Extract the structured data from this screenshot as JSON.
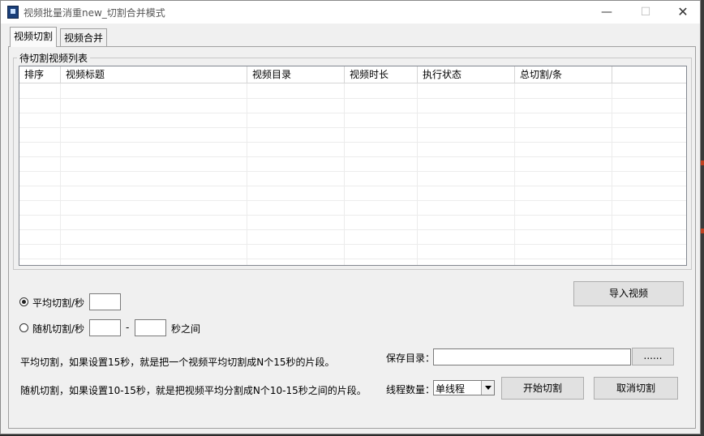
{
  "window": {
    "title": "视频批量消重new_切割合并模式"
  },
  "tabs": [
    {
      "label": "视频切割",
      "active": true
    },
    {
      "label": "视频合并",
      "active": false
    }
  ],
  "list": {
    "group_title": "待切割视频列表",
    "columns": [
      "排序",
      "视频标题",
      "视频目录",
      "视频时长",
      "执行状态",
      "总切割/条",
      ""
    ],
    "rows": []
  },
  "controls": {
    "import_button": "导入视频",
    "avg_cut": {
      "label": "平均切割/秒",
      "value": "",
      "selected": true
    },
    "random_cut": {
      "label": "随机切割/秒",
      "min_value": "",
      "max_value": "",
      "separator": "-",
      "suffix": "秒之间",
      "selected": false
    },
    "avg_desc": "平均切割，如果设置15秒，就是把一个视频平均切割成N个15秒的片段。",
    "random_desc": "随机切割，如果设置10-15秒，就是把视频平均分割成N个10-15秒之间的片段。",
    "save_dir": {
      "label": "保存目录：",
      "value": "",
      "browse_button": "......"
    },
    "threads": {
      "label": "线程数量：",
      "selected": "单线程"
    },
    "start_button": "开始切割",
    "cancel_button": "取消切割"
  },
  "icons": {
    "app": "app-icon",
    "minimize": "minimize-icon",
    "maximize": "maximize-icon",
    "close": "close-icon"
  }
}
